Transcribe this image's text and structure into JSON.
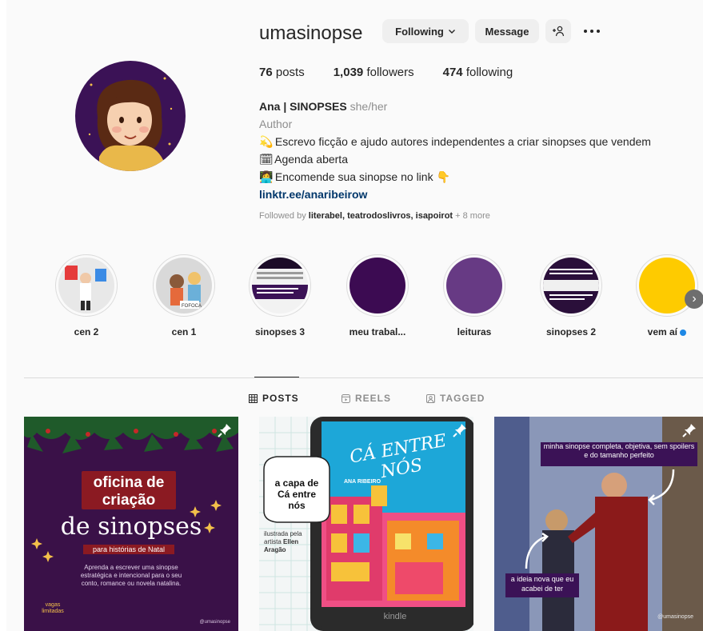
{
  "profile": {
    "username": "umasinopse",
    "following_btn": "Following",
    "message_btn": "Message",
    "stats": {
      "posts_count": "76",
      "posts_label": "posts",
      "followers_count": "1,039",
      "followers_label": "followers",
      "following_count": "474",
      "following_label": "following"
    },
    "bio": {
      "name": "Ana | SINOPSES",
      "pronouns": "she/her",
      "category": "Author",
      "line1_emoji": "💫",
      "line1": "Escrevo ficção e ajudo autores independentes a criar sinopses que vendem",
      "line2_emoji": "🗓",
      "line2": "Agenda aberta",
      "line3_emoji": "👩‍💻",
      "line3": "Encomende sua sinopse no link",
      "line3_end_emoji": "👇",
      "link": "linktr.ee/anaribeirow"
    },
    "followed_by": {
      "prefix": "Followed by",
      "names": "literabel, teatrodoslivros, isapoirot",
      "more": "+ 8 more"
    }
  },
  "highlights": [
    {
      "label": "cen 2"
    },
    {
      "label": "cen 1"
    },
    {
      "label": "sinopses 3"
    },
    {
      "label": "meu trabal..."
    },
    {
      "label": "leituras"
    },
    {
      "label": "sinopses 2"
    },
    {
      "label": "vem aí"
    }
  ],
  "tabs": [
    {
      "label": "POSTS",
      "icon": "grid-icon"
    },
    {
      "label": "REELS",
      "icon": "reels-icon"
    },
    {
      "label": "TAGGED",
      "icon": "tagged-icon"
    }
  ],
  "posts": [
    {
      "title1": "oficina de",
      "title2": "criação",
      "title3": "de sinopses",
      "tag": "para histórias de Natal",
      "desc": "Aprenda a escrever uma sinopse estratégica e intencional para o seu conto, romance ou novela natalina.",
      "vagas": "vagas limitadas",
      "handle": "@umasinopse"
    },
    {
      "bubble": "a capa de Cá entre nós",
      "credit_prefix": "ilustrada pela artista",
      "artist": "Ellen Aragão",
      "book_title": "CÁ ENTRE NÓS",
      "book_author": "ANA RIBEIRO",
      "kindle": "kindle"
    },
    {
      "top_caption": "minha sinopse completa, objetiva, sem spoilers e do tamanho perfeito",
      "bottom_caption": "a ideia nova que eu acabei de ter",
      "handle": "@umasinopse"
    }
  ]
}
